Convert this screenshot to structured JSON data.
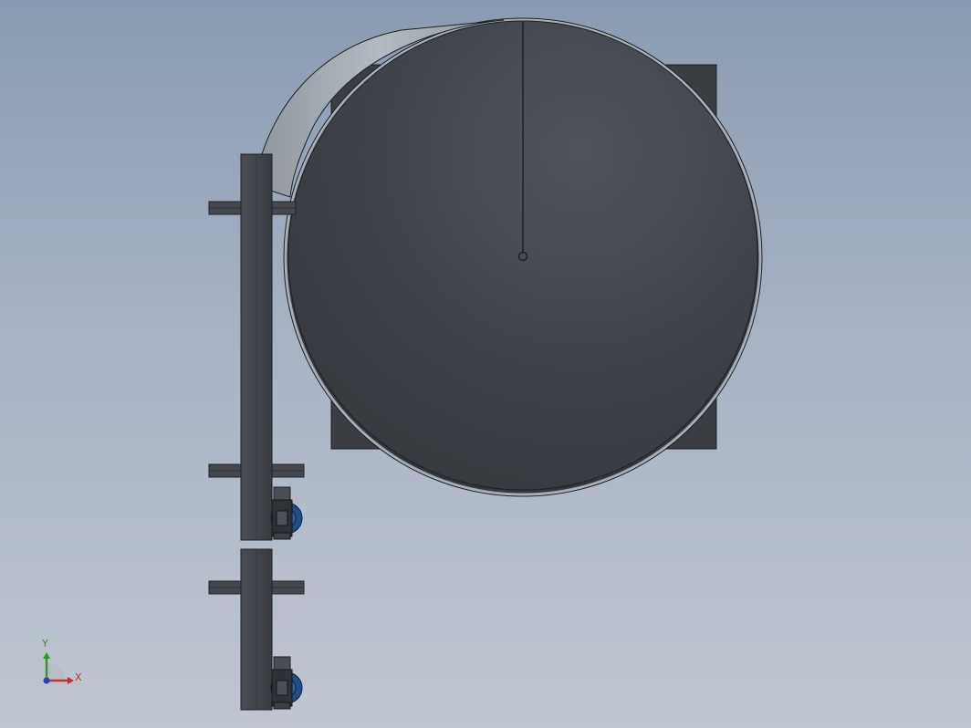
{
  "triad": {
    "x_label": "X",
    "y_label": "Y"
  },
  "colors": {
    "background_top": "#8a9bb1",
    "background_bottom": "#c0c6d1",
    "part_dark": "#3b3f45",
    "part_edge": "#1e2126",
    "motor_blue": "#1f4f86",
    "axis_x": "#c23030",
    "axis_y": "#2a9a2a",
    "axis_z": "#2a3fb8"
  }
}
